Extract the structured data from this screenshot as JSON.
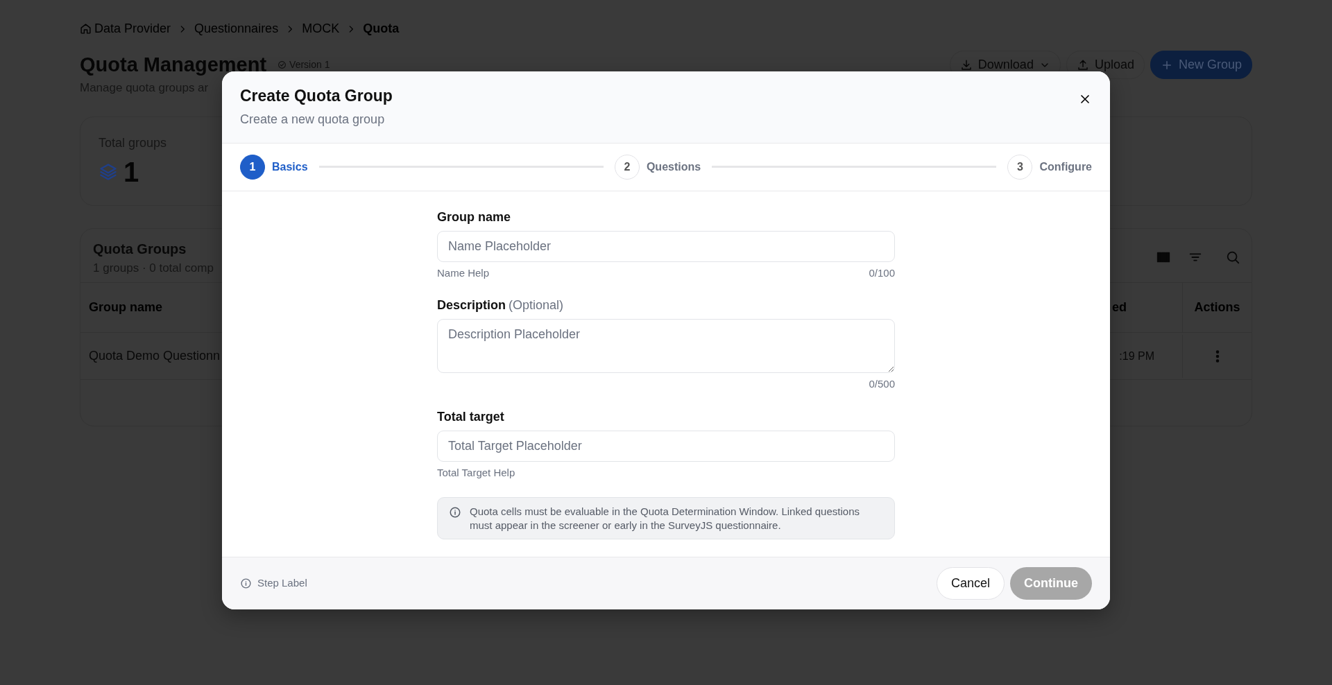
{
  "breadcrumb": [
    {
      "label": "Data Provider",
      "kind": "home",
      "current": false
    },
    {
      "label": "Questionnaires",
      "current": false
    },
    {
      "label": "MOCK",
      "current": false
    },
    {
      "label": "Quota",
      "current": true
    }
  ],
  "page": {
    "title": "Quota Management",
    "version": "Version 1",
    "subtitle": "Manage quota groups ar",
    "actions": [
      {
        "label": "Download",
        "kind": "dropdown"
      },
      {
        "label": "Upload",
        "kind": "upload"
      },
      {
        "label": "New Group",
        "kind": "primary"
      }
    ]
  },
  "stats": [
    {
      "label": "Total groups",
      "value": "1"
    }
  ],
  "groups_table": {
    "title": "Quota Groups",
    "summary": "1 groups · 0 total comp",
    "columns": [
      "Group name",
      "ed",
      "Actions"
    ],
    "rows": [
      {
        "cells": [
          "Quota Demo Questionn",
          ":19 PM"
        ]
      }
    ]
  },
  "modal": {
    "title": "Create Quota Group",
    "subtitle": "Create a new quota group",
    "steps": [
      {
        "number": "1",
        "label": "Basics",
        "selected": true
      },
      {
        "number": "2",
        "label": "Questions",
        "selected": false
      },
      {
        "number": "3",
        "label": "Configure",
        "selected": false
      }
    ],
    "fields": [
      {
        "kind": "input",
        "label": "Group name",
        "placeholder": "Name Placeholder",
        "help": "Name Help",
        "counter": "0/100"
      },
      {
        "kind": "textarea",
        "label": "Description",
        "optional": "(Optional)",
        "placeholder": "Description Placeholder",
        "counter": "0/500"
      },
      {
        "kind": "input",
        "label": "Total target",
        "placeholder": "Total Target Placeholder",
        "help": "Total Target Help"
      }
    ],
    "notice": "Quota cells must be evaluable in the Quota Determination Window. Linked questions must appear in the screener or early in the SurveyJS questionnaire.",
    "footer": {
      "step_label": "Step Label",
      "cancel": "Cancel",
      "continue": {
        "label": "Continue",
        "disabled": true
      }
    }
  }
}
